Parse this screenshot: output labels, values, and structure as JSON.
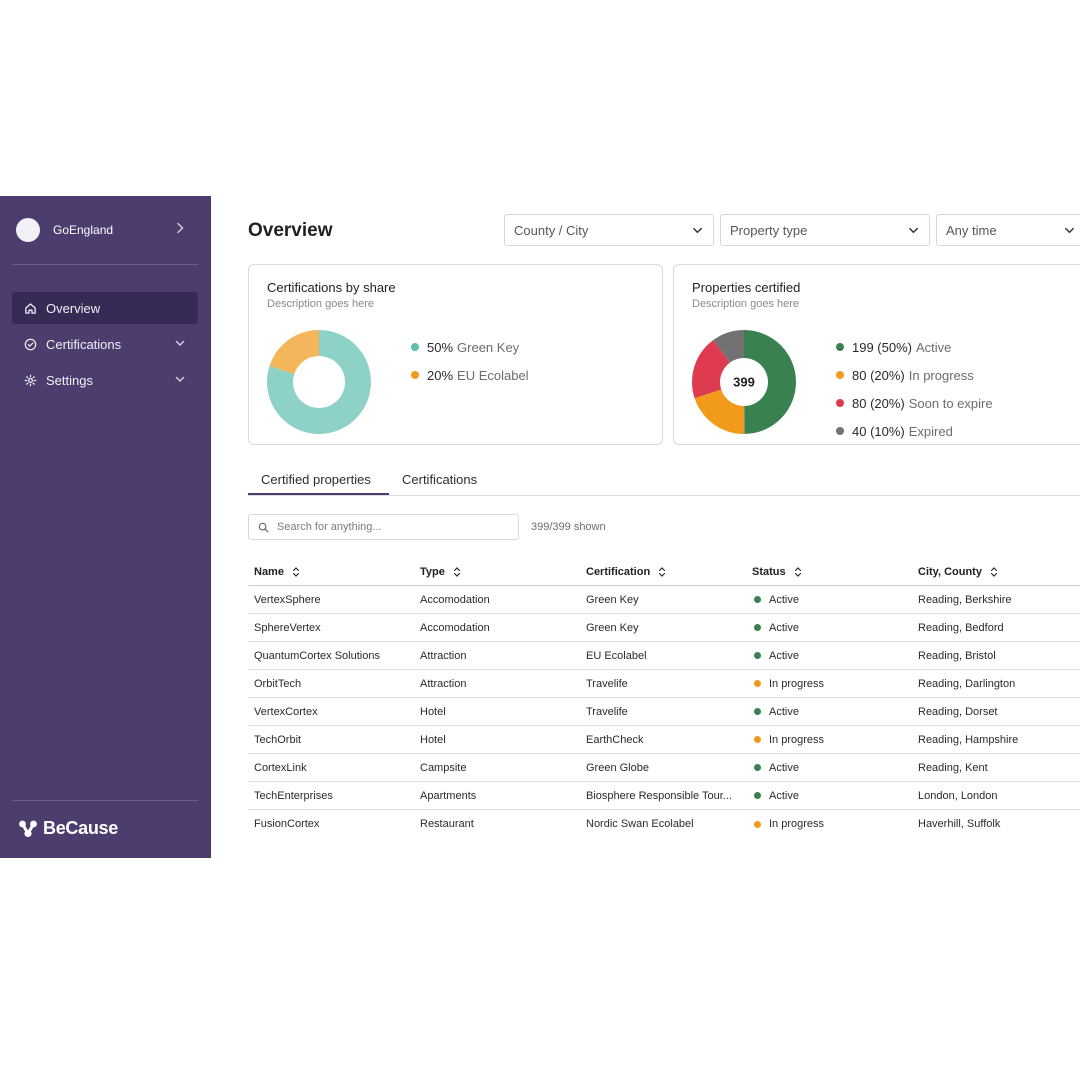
{
  "sidebar": {
    "org_name": "GoEngland",
    "nav": [
      {
        "label": "Overview",
        "icon": "home-icon",
        "active": true
      },
      {
        "label": "Certifications",
        "icon": "check-circle-icon",
        "active": false
      },
      {
        "label": "Settings",
        "icon": "gear-icon",
        "active": false
      }
    ],
    "brand": "BeCause"
  },
  "header": {
    "title": "Overview",
    "filters": [
      "County / City",
      "Property type",
      "Any time"
    ]
  },
  "cards": {
    "share": {
      "title": "Certifications by share",
      "description": "Description goes here",
      "legend": [
        {
          "value": "50%",
          "label": "Green Key",
          "color": "#8ed1c6"
        },
        {
          "value": "20%",
          "label": "EU Ecolabel",
          "color": "#f4b65a"
        }
      ]
    },
    "properties": {
      "title": "Properties certified",
      "description": "Description goes here",
      "total": "399",
      "legend": [
        {
          "value": "199 (50%)",
          "label": "Active",
          "color": "#3a8151"
        },
        {
          "value": "80 (20%)",
          "label": "In progress",
          "color": "#f29a1c"
        },
        {
          "value": "80 (20%)",
          "label": "Soon to expire",
          "color": "#de3a50"
        },
        {
          "value": "40 (10%)",
          "label": "Expired",
          "color": "#727272"
        }
      ]
    }
  },
  "tabs": [
    "Certified properties",
    "Certifications"
  ],
  "search": {
    "placeholder": "Search for anything...",
    "shown": "399/399 shown"
  },
  "table": {
    "columns": [
      "Name",
      "Type",
      "Certification",
      "Status",
      "City, County"
    ],
    "rows": [
      {
        "name": "VertexSphere",
        "type": "Accomodation",
        "certification": "Green Key",
        "status": "Active",
        "location": "Reading, Berkshire"
      },
      {
        "name": "SphereVertex",
        "type": "Accomodation",
        "certification": "Green Key",
        "status": "Active",
        "location": "Reading, Bedford"
      },
      {
        "name": "QuantumCortex Solutions",
        "type": "Attraction",
        "certification": "EU Ecolabel",
        "status": "Active",
        "location": "Reading, Bristol"
      },
      {
        "name": "OrbitTech",
        "type": "Attraction",
        "certification": "Travelife",
        "status": "In progress",
        "location": "Reading, Darlington"
      },
      {
        "name": "VertexCortex",
        "type": "Hotel",
        "certification": "Travelife",
        "status": "Active",
        "location": "Reading, Dorset"
      },
      {
        "name": "TechOrbit",
        "type": "Hotel",
        "certification": "EarthCheck",
        "status": "In progress",
        "location": "Reading, Hampshire"
      },
      {
        "name": "CortexLink",
        "type": "Campsite",
        "certification": "Green Globe",
        "status": "Active",
        "location": "Reading, Kent"
      },
      {
        "name": "TechEnterprises",
        "type": "Apartments",
        "certification": "Biosphere Responsible Tour...",
        "status": "Active",
        "location": "London, London"
      },
      {
        "name": "FusionCortex",
        "type": "Restaurant",
        "certification": "Nordic Swan Ecolabel",
        "status": "In progress",
        "location": "Haverhill, Suffolk"
      }
    ]
  },
  "status_colors": {
    "Active": "#3a8151",
    "In progress": "#f29a1c"
  },
  "chart_data": [
    {
      "type": "pie",
      "title": "Certifications by share",
      "labels": [
        "Green Key",
        "EU Ecolabel"
      ],
      "values": [
        80,
        20
      ],
      "colors": [
        "#8ed1c6",
        "#f4b65a"
      ]
    },
    {
      "type": "pie",
      "title": "Properties certified",
      "labels": [
        "Active",
        "In progress",
        "Soon to expire",
        "Expired"
      ],
      "values": [
        199,
        80,
        80,
        40
      ],
      "colors": [
        "#3a8151",
        "#f29a1c",
        "#de3a50",
        "#727272"
      ]
    }
  ]
}
